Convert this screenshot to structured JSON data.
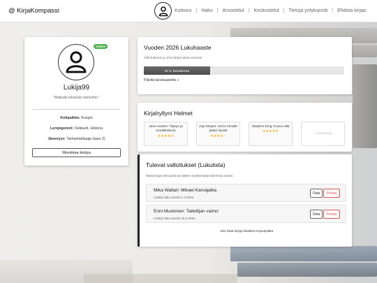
{
  "header": {
    "brand": "@ KirjaKompassi",
    "nav": [
      "Kotisivu",
      "Haku",
      "Arvostelut",
      "Keskustelut",
      "Tietoja yrityksestä",
      "Ehdota kirjaa"
    ]
  },
  "profile": {
    "status": "Online",
    "username": "Lukija99",
    "motto": "\"Matkalla tuhansiin tarinoihin.\"",
    "hometown_label": "Kotipaikka:",
    "hometown": "Kuopio",
    "genres_label": "Lempigenret:",
    "genres": "Dekkarit, Historia",
    "level_label": "Jäsenyys:",
    "level": "Tarinamatkaaja (taso 2)",
    "edit_button": "Muokkaa tietoja"
  },
  "challenge": {
    "title": "Vuoden 2026 Lukuhaaste",
    "text": "Olet lukenut jo 4/12 kirjaa tänä vuonna!",
    "progress_label": "33 % Tavoitteesta",
    "progress_fraction": 0.33,
    "link": "Päivitä lukuhaastetta »"
  },
  "shelf": {
    "title": "Kirjahyllyni Helmet",
    "books": [
      {
        "title": "Jane Austen: Ylpeys ja ennakkoluulo",
        "stars": "★★★★★"
      },
      {
        "title": "Jojo Moyes: Kerro minulle jotain hyvää",
        "stars": "★★★★☆"
      },
      {
        "title": "Stephen King: Kuvun alla",
        "stars": "★★★★★"
      }
    ],
    "add_label": "+ Lisää kirja"
  },
  "wishlist": {
    "title": "Tulevat valloitukset (Lukulista)",
    "subtitle": "Nämä kirjat olet poiminut talteen myöhempää lukemista varten:",
    "items": [
      {
        "title": "Mika Waltari: Mikael Karvajalka",
        "date": "Lisätty haku-sivulta 1.3.2026"
      },
      {
        "title": "Enni Mustonen: Taiteilijan vaimo",
        "date": "Lisätty haku-sivulta 28.2.2026"
      }
    ],
    "buy_label": "Osta",
    "delete_label": "Poista",
    "more_link": "Etsi lisää kirjoja listallesi Kirjaväylältä"
  }
}
